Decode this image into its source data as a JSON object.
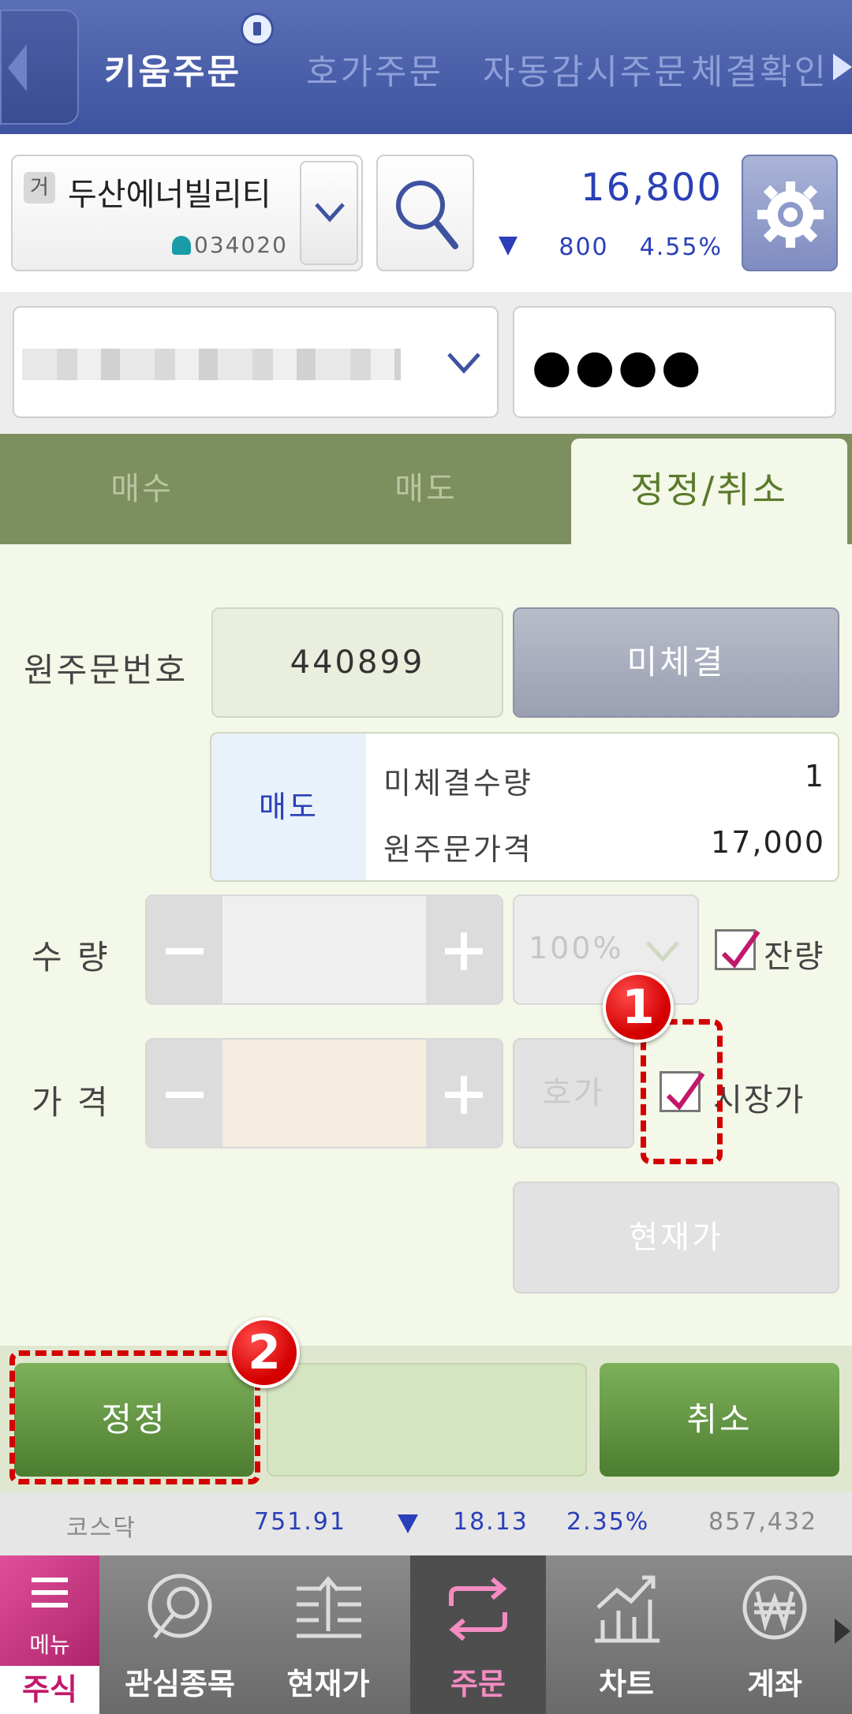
{
  "header": {
    "tabs": [
      {
        "label": "키움주문",
        "active": true
      },
      {
        "label": "호가주문",
        "active": false
      },
      {
        "label": "자동감시주문",
        "active": false
      },
      {
        "label": "체결확인",
        "active": false
      }
    ]
  },
  "stock": {
    "exchange_badge": "거",
    "name": "두산에너빌리티",
    "code": "034020",
    "price": "16,800",
    "change": "800",
    "change_rate": "4.55%",
    "change_direction": "down",
    "price_color": "#2a3fb8"
  },
  "account": {
    "number_masked": "",
    "password_mask": "●●●●"
  },
  "order_tabs": [
    {
      "label": "매수",
      "active": false
    },
    {
      "label": "매도",
      "active": false
    },
    {
      "label": "정정/취소",
      "active": true
    }
  ],
  "form": {
    "orig_order_label": "원주문번호",
    "orig_order_no": "440899",
    "unfilled_button": "미체결",
    "side": "매도",
    "unfilled_qty_label": "미체결수량",
    "unfilled_qty": "1",
    "orig_price_label": "원주문가격",
    "orig_price": "17,000",
    "qty_label": "수 량",
    "qty_percent": "100%",
    "remaining_label": "잔량",
    "remaining_checked": true,
    "price_label": "가 격",
    "hoga_button": "호가",
    "market_price_label": "시장가",
    "market_price_checked": true,
    "current_price_button": "현재가"
  },
  "markers": {
    "one": "1",
    "two": "2",
    "color": "#d40000"
  },
  "actions": {
    "modify": "정정",
    "cancel": "취소"
  },
  "ticker": {
    "name": "코스닥",
    "value": "751.91",
    "change": "18.13",
    "rate": "2.35%",
    "volume": "857,432"
  },
  "bottom_nav": {
    "menu_label": "메뉴",
    "stock_label": "주식",
    "items": [
      {
        "label": "관심종목",
        "icon": "watchlist-icon"
      },
      {
        "label": "현재가",
        "icon": "current-price-icon"
      },
      {
        "label": "주문",
        "icon": "order-icon",
        "active": true
      },
      {
        "label": "차트",
        "icon": "chart-icon"
      },
      {
        "label": "계좌",
        "icon": "won-icon"
      }
    ]
  }
}
